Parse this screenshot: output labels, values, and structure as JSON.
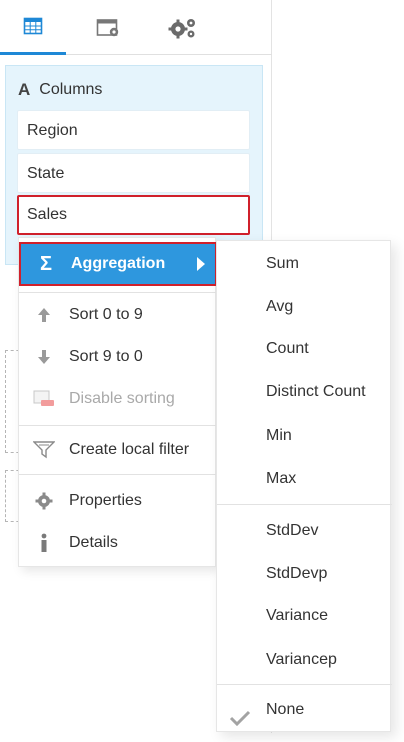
{
  "tabs": [
    {
      "icon": "table-icon",
      "active": true
    },
    {
      "icon": "window-settings-icon",
      "active": false
    },
    {
      "icon": "gears-icon",
      "active": false
    }
  ],
  "columns": {
    "title": "Columns",
    "items": [
      "Region",
      "State",
      "Sales"
    ]
  },
  "context_menu": {
    "aggregation": "Aggregation",
    "sort_asc": "Sort 0 to 9",
    "sort_desc": "Sort 9 to 0",
    "disable_sorting": "Disable sorting",
    "create_filter": "Create local filter",
    "properties": "Properties",
    "details": "Details"
  },
  "aggregation_menu": {
    "items": [
      "Sum",
      "Avg",
      "Count",
      "Distinct Count",
      "Min",
      "Max",
      "StdDev",
      "StdDevp",
      "Variance",
      "Variancep",
      "None"
    ],
    "checked": "None"
  },
  "colors": {
    "accent": "#2e97de",
    "highlight_border": "#d0202b",
    "panel_bg": "#e5f4fc"
  }
}
